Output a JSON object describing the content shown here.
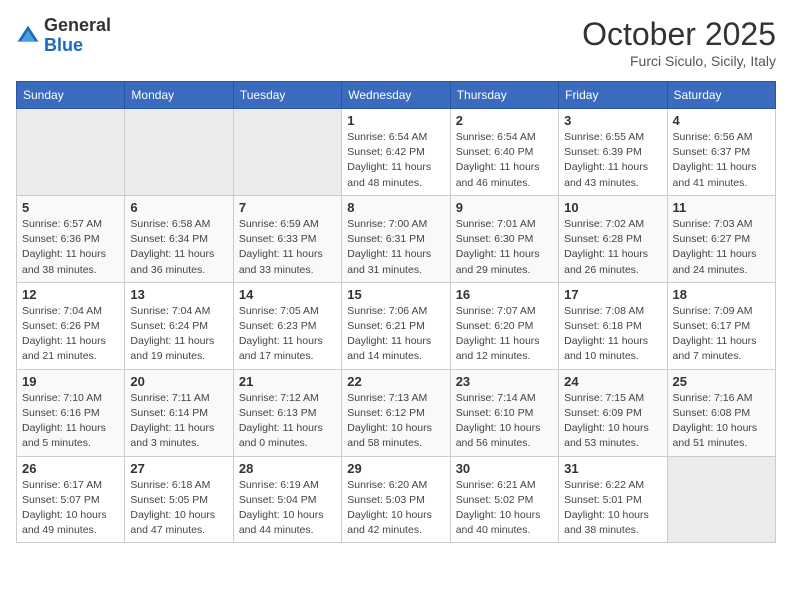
{
  "header": {
    "logo_general": "General",
    "logo_blue": "Blue",
    "month": "October 2025",
    "location": "Furci Siculo, Sicily, Italy"
  },
  "weekdays": [
    "Sunday",
    "Monday",
    "Tuesday",
    "Wednesday",
    "Thursday",
    "Friday",
    "Saturday"
  ],
  "weeks": [
    [
      {
        "day": "",
        "info": ""
      },
      {
        "day": "",
        "info": ""
      },
      {
        "day": "",
        "info": ""
      },
      {
        "day": "1",
        "info": "Sunrise: 6:54 AM\nSunset: 6:42 PM\nDaylight: 11 hours\nand 48 minutes."
      },
      {
        "day": "2",
        "info": "Sunrise: 6:54 AM\nSunset: 6:40 PM\nDaylight: 11 hours\nand 46 minutes."
      },
      {
        "day": "3",
        "info": "Sunrise: 6:55 AM\nSunset: 6:39 PM\nDaylight: 11 hours\nand 43 minutes."
      },
      {
        "day": "4",
        "info": "Sunrise: 6:56 AM\nSunset: 6:37 PM\nDaylight: 11 hours\nand 41 minutes."
      }
    ],
    [
      {
        "day": "5",
        "info": "Sunrise: 6:57 AM\nSunset: 6:36 PM\nDaylight: 11 hours\nand 38 minutes."
      },
      {
        "day": "6",
        "info": "Sunrise: 6:58 AM\nSunset: 6:34 PM\nDaylight: 11 hours\nand 36 minutes."
      },
      {
        "day": "7",
        "info": "Sunrise: 6:59 AM\nSunset: 6:33 PM\nDaylight: 11 hours\nand 33 minutes."
      },
      {
        "day": "8",
        "info": "Sunrise: 7:00 AM\nSunset: 6:31 PM\nDaylight: 11 hours\nand 31 minutes."
      },
      {
        "day": "9",
        "info": "Sunrise: 7:01 AM\nSunset: 6:30 PM\nDaylight: 11 hours\nand 29 minutes."
      },
      {
        "day": "10",
        "info": "Sunrise: 7:02 AM\nSunset: 6:28 PM\nDaylight: 11 hours\nand 26 minutes."
      },
      {
        "day": "11",
        "info": "Sunrise: 7:03 AM\nSunset: 6:27 PM\nDaylight: 11 hours\nand 24 minutes."
      }
    ],
    [
      {
        "day": "12",
        "info": "Sunrise: 7:04 AM\nSunset: 6:26 PM\nDaylight: 11 hours\nand 21 minutes."
      },
      {
        "day": "13",
        "info": "Sunrise: 7:04 AM\nSunset: 6:24 PM\nDaylight: 11 hours\nand 19 minutes."
      },
      {
        "day": "14",
        "info": "Sunrise: 7:05 AM\nSunset: 6:23 PM\nDaylight: 11 hours\nand 17 minutes."
      },
      {
        "day": "15",
        "info": "Sunrise: 7:06 AM\nSunset: 6:21 PM\nDaylight: 11 hours\nand 14 minutes."
      },
      {
        "day": "16",
        "info": "Sunrise: 7:07 AM\nSunset: 6:20 PM\nDaylight: 11 hours\nand 12 minutes."
      },
      {
        "day": "17",
        "info": "Sunrise: 7:08 AM\nSunset: 6:18 PM\nDaylight: 11 hours\nand 10 minutes."
      },
      {
        "day": "18",
        "info": "Sunrise: 7:09 AM\nSunset: 6:17 PM\nDaylight: 11 hours\nand 7 minutes."
      }
    ],
    [
      {
        "day": "19",
        "info": "Sunrise: 7:10 AM\nSunset: 6:16 PM\nDaylight: 11 hours\nand 5 minutes."
      },
      {
        "day": "20",
        "info": "Sunrise: 7:11 AM\nSunset: 6:14 PM\nDaylight: 11 hours\nand 3 minutes."
      },
      {
        "day": "21",
        "info": "Sunrise: 7:12 AM\nSunset: 6:13 PM\nDaylight: 11 hours\nand 0 minutes."
      },
      {
        "day": "22",
        "info": "Sunrise: 7:13 AM\nSunset: 6:12 PM\nDaylight: 10 hours\nand 58 minutes."
      },
      {
        "day": "23",
        "info": "Sunrise: 7:14 AM\nSunset: 6:10 PM\nDaylight: 10 hours\nand 56 minutes."
      },
      {
        "day": "24",
        "info": "Sunrise: 7:15 AM\nSunset: 6:09 PM\nDaylight: 10 hours\nand 53 minutes."
      },
      {
        "day": "25",
        "info": "Sunrise: 7:16 AM\nSunset: 6:08 PM\nDaylight: 10 hours\nand 51 minutes."
      }
    ],
    [
      {
        "day": "26",
        "info": "Sunrise: 6:17 AM\nSunset: 5:07 PM\nDaylight: 10 hours\nand 49 minutes."
      },
      {
        "day": "27",
        "info": "Sunrise: 6:18 AM\nSunset: 5:05 PM\nDaylight: 10 hours\nand 47 minutes."
      },
      {
        "day": "28",
        "info": "Sunrise: 6:19 AM\nSunset: 5:04 PM\nDaylight: 10 hours\nand 44 minutes."
      },
      {
        "day": "29",
        "info": "Sunrise: 6:20 AM\nSunset: 5:03 PM\nDaylight: 10 hours\nand 42 minutes."
      },
      {
        "day": "30",
        "info": "Sunrise: 6:21 AM\nSunset: 5:02 PM\nDaylight: 10 hours\nand 40 minutes."
      },
      {
        "day": "31",
        "info": "Sunrise: 6:22 AM\nSunset: 5:01 PM\nDaylight: 10 hours\nand 38 minutes."
      },
      {
        "day": "",
        "info": ""
      }
    ]
  ]
}
